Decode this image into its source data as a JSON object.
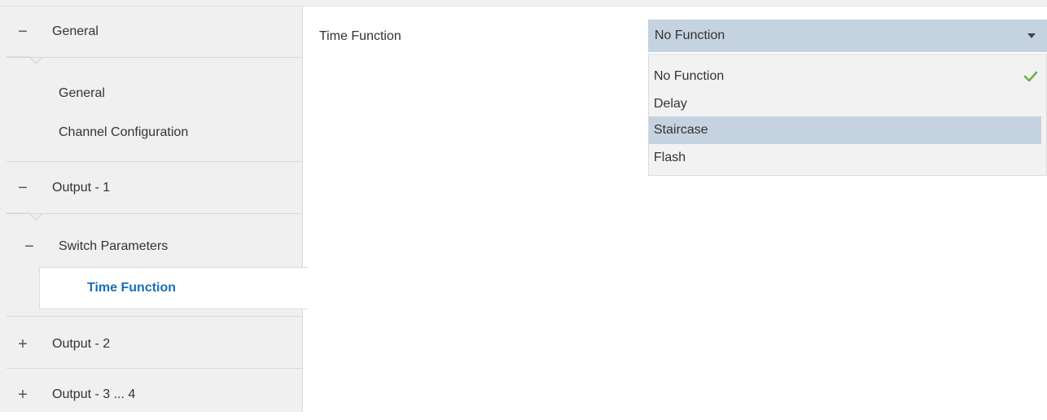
{
  "sidebar": {
    "items": [
      {
        "sign": "−",
        "label": "General"
      },
      {
        "label": "General"
      },
      {
        "label": "Channel Configuration"
      },
      {
        "sign": "−",
        "label": "Output - 1"
      },
      {
        "sign": "−",
        "label": "Switch Parameters"
      },
      {
        "label": "Time Function"
      },
      {
        "sign": "+",
        "label": "Output - 2"
      },
      {
        "sign": "+",
        "label": "Output - 3 ... 4"
      }
    ]
  },
  "main": {
    "parameter_label": "Time Function",
    "select": {
      "value": "No Function",
      "options": [
        "No Function",
        "Delay",
        "Staircase",
        "Flash"
      ],
      "checked_option": "No Function",
      "hovered_option": "Staircase"
    }
  },
  "colors": {
    "accent": "#1a6fb5",
    "select_bg": "#c5d2e0",
    "check": "#6bb042",
    "sidebar_bg": "#f0f0f0"
  },
  "icons": {
    "expanded": "minus-icon",
    "collapsed": "plus-icon",
    "dropdown": "caret-down-icon",
    "selected_marker": "checkmark-icon"
  }
}
